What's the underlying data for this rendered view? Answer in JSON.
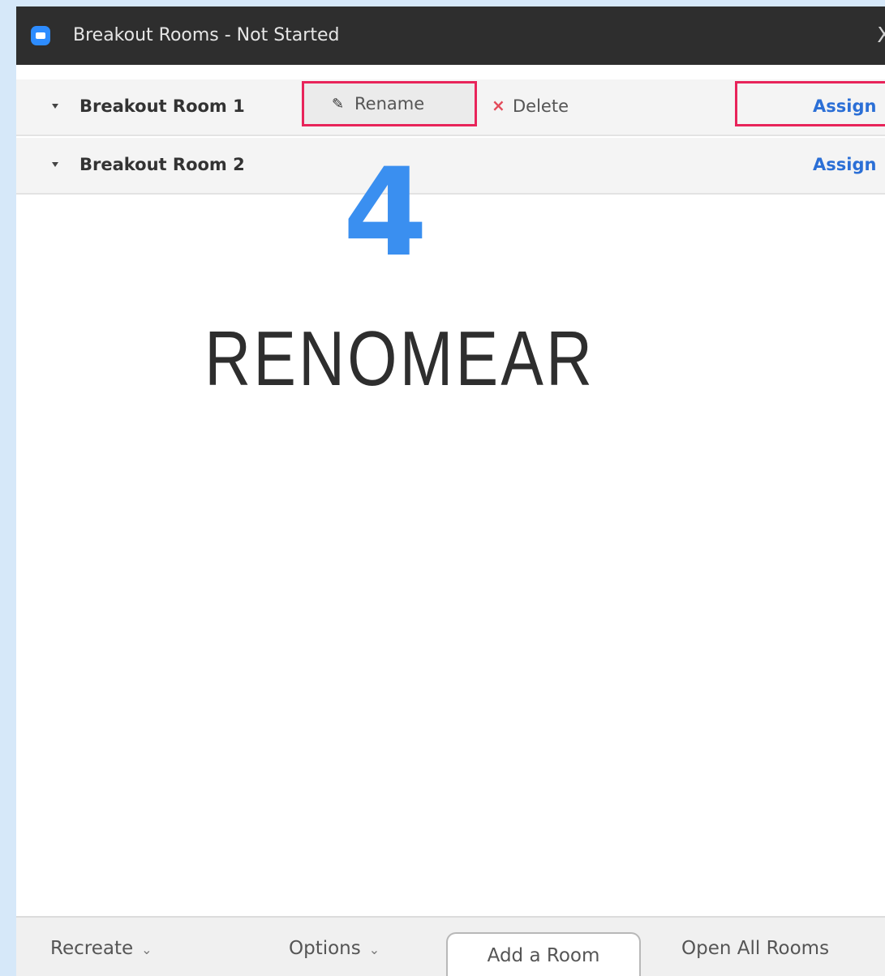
{
  "window": {
    "title": "Breakout Rooms - Not Started",
    "close_glyph": "X"
  },
  "rooms": [
    {
      "name": "Breakout Room 1",
      "rename_label": "Rename",
      "delete_label": "Delete",
      "assign_label": "Assign"
    },
    {
      "name": "Breakout Room 2",
      "assign_label": "Assign"
    }
  ],
  "annotation": {
    "step_number": "4",
    "caption": "RENOMEAR"
  },
  "footer": {
    "recreate_label": "Recreate",
    "options_label": "Options",
    "add_room_label": "Add a Room",
    "open_all_label": "Open All Rooms"
  },
  "icons": {
    "app": "zoom-app-icon",
    "close": "close-icon",
    "caret": "caret-down-icon",
    "pencil": "pencil-icon",
    "delete": "x-icon",
    "chevron": "chevron-down-icon"
  },
  "colors": {
    "highlight": "#e8245a",
    "link": "#2b6fd6",
    "step_number": "#3a8ff0",
    "delete": "#e34b5a"
  }
}
